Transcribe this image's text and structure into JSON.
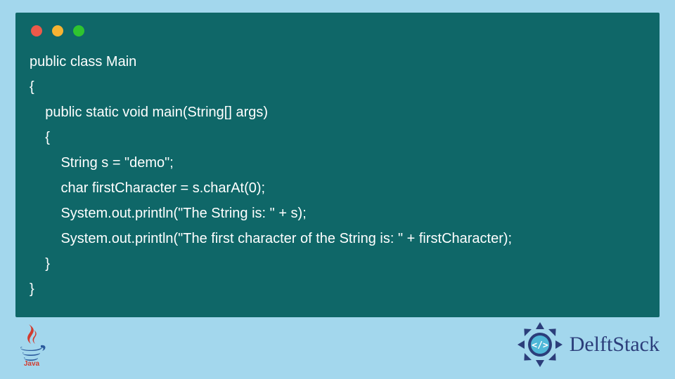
{
  "code": {
    "lines": [
      "public class Main",
      "{",
      "    public static void main(String[] args)",
      "    {",
      "        String s = \"demo\";",
      "        char firstCharacter = s.charAt(0);",
      "        System.out.println(\"The String is: \" + s);",
      "        System.out.println(\"The first character of the String is: \" + firstCharacter);",
      "    }",
      "}"
    ]
  },
  "footer": {
    "java_label": "Java",
    "brand": "DelftStack"
  }
}
